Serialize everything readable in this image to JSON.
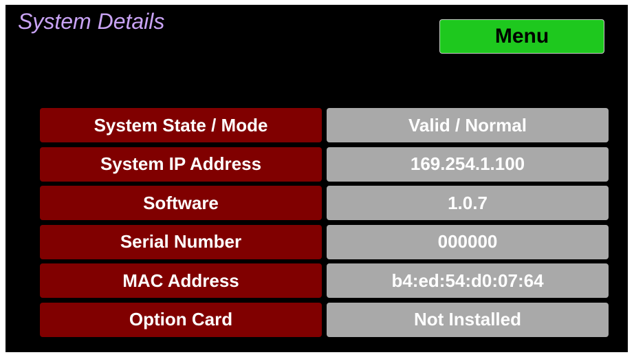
{
  "title": "System Details",
  "menu_label": "Menu",
  "colors": {
    "background": "#000000",
    "title": "#c9a3f5",
    "menu_button": "#1ec81e",
    "label_cell": "#800000",
    "value_cell": "#a9a9a9",
    "cell_text": "#ffffff"
  },
  "rows": [
    {
      "label": "System State / Mode",
      "value": "Valid / Normal"
    },
    {
      "label": "System IP Address",
      "value": "169.254.1.100"
    },
    {
      "label": "Software",
      "value": "1.0.7"
    },
    {
      "label": "Serial Number",
      "value": "000000"
    },
    {
      "label": "MAC Address",
      "value": "b4:ed:54:d0:07:64"
    },
    {
      "label": "Option Card",
      "value": "Not Installed"
    }
  ]
}
